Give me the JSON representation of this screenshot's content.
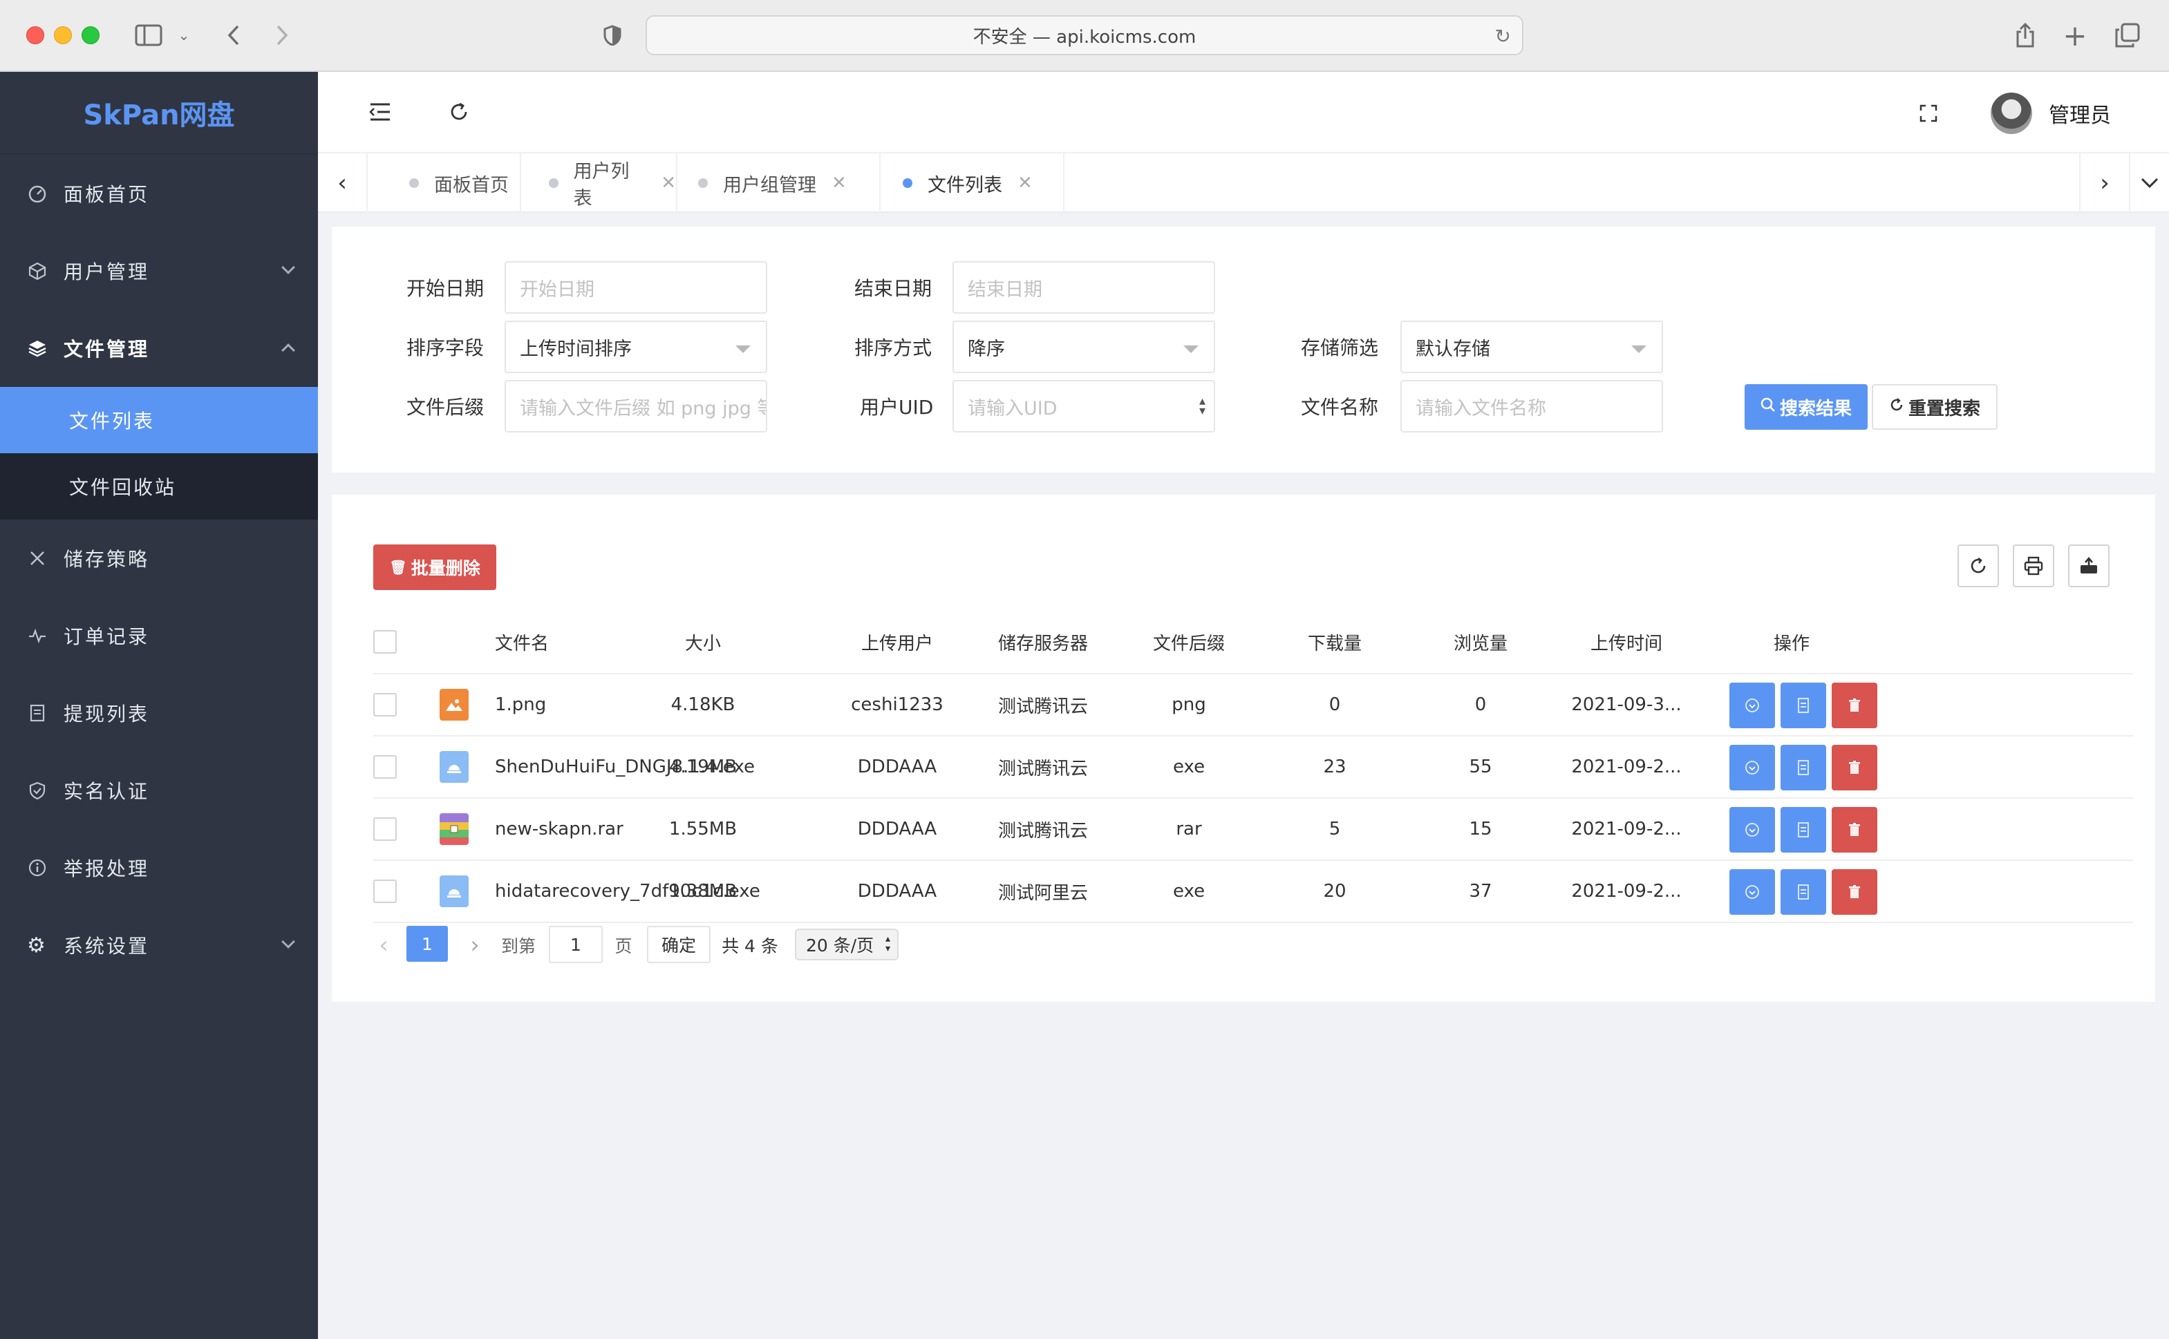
{
  "browser": {
    "url_text": "不安全 — api.koicms.com"
  },
  "sidebar": {
    "brand": "SkPan网盘",
    "items": [
      {
        "label": "面板首页",
        "icon": "dashboard-icon"
      },
      {
        "label": "用户管理",
        "icon": "cube-icon"
      },
      {
        "label": "文件管理",
        "icon": "layers-icon"
      },
      {
        "label": "储存策略",
        "icon": "tools-icon"
      },
      {
        "label": "订单记录",
        "icon": "pulse-icon"
      },
      {
        "label": "提现列表",
        "icon": "receipt-icon"
      },
      {
        "label": "实名认证",
        "icon": "shield-check-icon"
      },
      {
        "label": "举报处理",
        "icon": "info-circle-icon"
      },
      {
        "label": "系统设置",
        "icon": "gear-icon"
      }
    ],
    "submenu": [
      {
        "label": "文件列表",
        "active": true
      },
      {
        "label": "文件回收站",
        "active": false
      }
    ]
  },
  "header": {
    "admin_name": "管理员"
  },
  "tabs": [
    {
      "label": "面板首页",
      "active": false
    },
    {
      "label": "用户列表",
      "active": false
    },
    {
      "label": "用户组管理",
      "active": false
    },
    {
      "label": "文件列表",
      "active": true
    }
  ],
  "search": {
    "start_date_label": "开始日期",
    "start_date_placeholder": "开始日期",
    "end_date_label": "结束日期",
    "end_date_placeholder": "结束日期",
    "sort_field_label": "排序字段",
    "sort_field_value": "上传时间排序",
    "sort_order_label": "排序方式",
    "sort_order_value": "降序",
    "storage_label": "存储筛选",
    "storage_value": "默认存储",
    "suffix_label": "文件后缀",
    "suffix_placeholder": "请输入文件后缀 如 png jpg 等",
    "uid_label": "用户UID",
    "uid_placeholder": "请输入UID",
    "filename_label": "文件名称",
    "filename_placeholder": "请输入文件名称",
    "search_button": "搜索结果",
    "reset_button": "重置搜索"
  },
  "table": {
    "batch_delete": "批量删除",
    "columns": [
      "文件名",
      "大小",
      "上传用户",
      "储存服务器",
      "文件后缀",
      "下载量",
      "浏览量",
      "上传时间",
      "操作"
    ],
    "rows": [
      {
        "name": "1.png",
        "size": "4.18KB",
        "user": "ceshi1233",
        "server": "测试腾讯云",
        "ext": "png",
        "downloads": "0",
        "views": "0",
        "time": "2021-09-3...",
        "icon": "image-file-icon"
      },
      {
        "name": "ShenDuHuiFu_DNGJ8.1.4.exe",
        "size": "4.19MB",
        "user": "DDDAAA",
        "server": "测试腾讯云",
        "ext": "exe",
        "downloads": "23",
        "views": "55",
        "time": "2021-09-2...",
        "icon": "exe-file-icon"
      },
      {
        "name": "new-skapn.rar",
        "size": "1.55MB",
        "user": "DDDAAA",
        "server": "测试腾讯云",
        "ext": "rar",
        "downloads": "5",
        "views": "15",
        "time": "2021-09-2...",
        "icon": "archive-file-icon"
      },
      {
        "name": "hidatarecovery_7df90c1c.exe",
        "size": "1.38MB",
        "user": "DDDAAA",
        "server": "测试阿里云",
        "ext": "exe",
        "downloads": "20",
        "views": "37",
        "time": "2021-09-2...",
        "icon": "exe-file-icon"
      }
    ]
  },
  "pagination": {
    "current": "1",
    "goto_label": "到第",
    "goto_value": "1",
    "page_label": "页",
    "confirm": "确定",
    "total": "共 4 条",
    "page_size": "20 条/页"
  },
  "colors": {
    "accent": "#5b95f4",
    "danger": "#d9534f",
    "sidebar_bg": "#2f3542"
  }
}
